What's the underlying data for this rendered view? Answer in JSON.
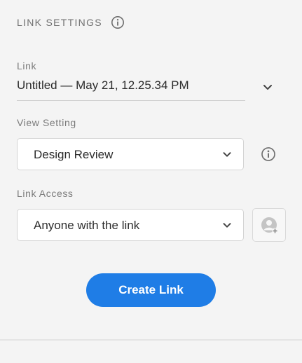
{
  "header": {
    "title": "LINK SETTINGS"
  },
  "link": {
    "label": "Link",
    "value": "Untitled — May 21, 12.25.34 PM"
  },
  "view_setting": {
    "label": "View Setting",
    "selected": "Design Review"
  },
  "link_access": {
    "label": "Link Access",
    "selected": "Anyone with the link"
  },
  "actions": {
    "create_label": "Create Link"
  },
  "icons": {
    "header_info": "info-icon",
    "link_dropdown": "chevron-down-icon",
    "view_info": "info-icon",
    "add_person": "add-person-icon"
  },
  "colors": {
    "accent": "#1f7de6",
    "background": "#f4f4f4",
    "text": "#2c2c2c",
    "muted_label": "#7a7a7a"
  }
}
